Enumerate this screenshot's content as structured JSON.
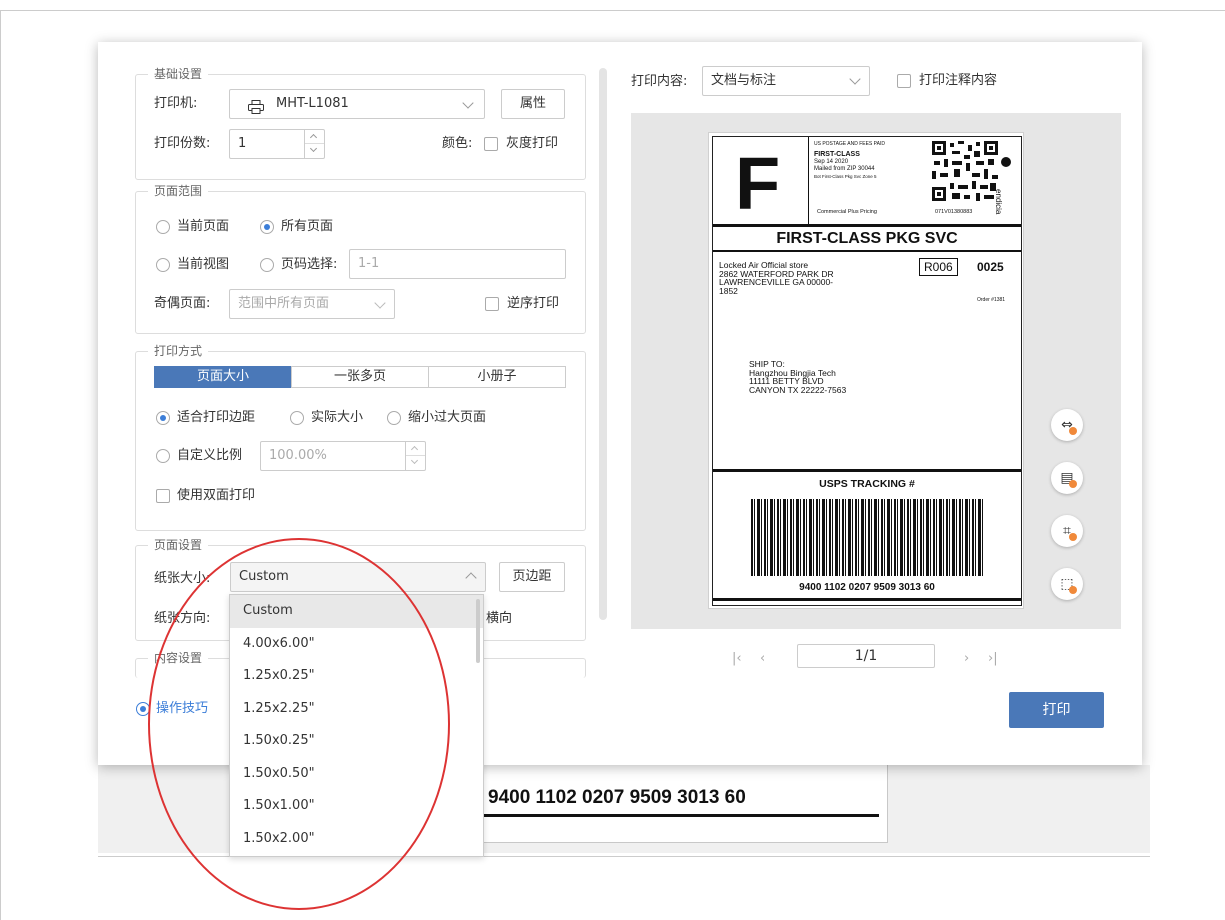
{
  "basic": {
    "legend": "基础设置",
    "printer_label": "打印机:",
    "printer_value": "MHT-L1081",
    "properties_button": "属性",
    "copies_label": "打印份数:",
    "copies_value": "1",
    "color_label": "颜色:",
    "grayscale_label": "灰度打印"
  },
  "range": {
    "legend": "页面范围",
    "current_page": "当前页面",
    "all_pages": "所有页面",
    "current_view": "当前视图",
    "page_select": "页码选择:",
    "page_select_value": "1-1",
    "odd_even_label": "奇偶页面:",
    "odd_even_value": "范围中所有页面",
    "reverse_label": "逆序打印"
  },
  "mode": {
    "legend": "打印方式",
    "tabs": [
      "页面大小",
      "一张多页",
      "小册子"
    ],
    "fit_margins": "适合打印边距",
    "actual_size": "实际大小",
    "shrink_large": "缩小过大页面",
    "custom_scale": "自定义比例",
    "custom_scale_value": "100.00%",
    "duplex": "使用双面打印"
  },
  "page_setup": {
    "legend": "页面设置",
    "paper_size_label": "纸张大小:",
    "paper_size_value": "Custom",
    "margins_button": "页边距",
    "orientation_label": "纸张方向:",
    "orientation_partial": "横向",
    "options": [
      "Custom",
      "4.00x6.00\"",
      "1.25x0.25\"",
      "1.25x2.25\"",
      "1.50x0.25\"",
      "1.50x0.50\"",
      "1.50x1.00\"",
      "1.50x2.00\""
    ]
  },
  "content_setup": {
    "legend": "内容设置"
  },
  "tips": {
    "label": "操作技巧"
  },
  "right": {
    "print_content_label": "打印内容:",
    "print_content_value": "文档与标注",
    "print_annotations_label": "打印注释内容",
    "page_indicator": "1/1",
    "print_button": "打印"
  },
  "shipping_label": {
    "big_letter": "F",
    "postage_header": "US POSTAGE AND FEES PAID",
    "class": "FIRST-CLASS",
    "date": "Sep 14 2020",
    "mailed_from": "Mailed from ZIP 30044",
    "service_line": "Bot First-Class Pkg Svc Zone 5",
    "pricing": "Commercial Plus Pricing",
    "account": "071V01380883",
    "brand": "endicia",
    "service_title": "FIRST-CLASS PKG SVC",
    "sender_lines": [
      "Locked Air Official store",
      "2862 WATERFORD PARK DR",
      "LAWRENCEVILLE GA  00000-",
      "1852"
    ],
    "route_code": "R006",
    "route_num": "0025",
    "order": "Order #1381",
    "ship_to_lines": [
      "SHIP TO:",
      "Hangzhou Bingjia Tech",
      "11111 BETTY BLVD",
      "CANYON TX 22222-7563"
    ],
    "tracking_title": "USPS TRACKING #",
    "tracking_number": "9400 1102 0207 9509 3013 60"
  },
  "background_doc": {
    "tracking_number": "9400 1102 0207 9509 3013 60"
  },
  "colors": {
    "accent": "#4a78b8",
    "annotation": "#d33333",
    "tool_dot": "#f0893a"
  }
}
